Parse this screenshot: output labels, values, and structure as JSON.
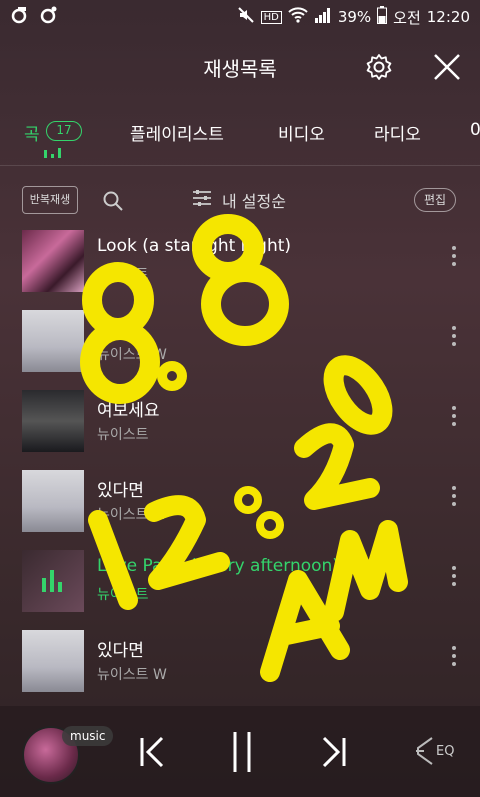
{
  "status": {
    "signal_pct": "39%",
    "ampm": "오전",
    "time": "12:20",
    "hd_label": "HD"
  },
  "header": {
    "title": "재생목록"
  },
  "tabs": [
    {
      "label": "곡",
      "count": "17",
      "active": true
    },
    {
      "label": "플레이리스트"
    },
    {
      "label": "비디오"
    },
    {
      "label": "라디오"
    },
    {
      "label": "0"
    }
  ],
  "toolbar": {
    "repeat_label": "반복재생",
    "sort_label": "내 설정순",
    "edit_label": "편집"
  },
  "songs": [
    {
      "title": "Look (a starlight night)",
      "artist": "뉴이스트"
    },
    {
      "title": "있다면",
      "artist": "뉴이스트 W"
    },
    {
      "title": "여보세요",
      "artist": "뉴이스트"
    },
    {
      "title": "있다면",
      "artist": "뉴이스트 W"
    },
    {
      "title": "Love Paint (every afternoon)",
      "artist": "뉴이스트",
      "playing": true
    },
    {
      "title": "있다면",
      "artist": "뉴이스트 W"
    }
  ],
  "player": {
    "badge": "music",
    "eq_label": "EQ"
  },
  "accent": "#34d46b",
  "overlay_text": {
    "date": "8.8",
    "time": "12:20",
    "ampm": "AM"
  }
}
